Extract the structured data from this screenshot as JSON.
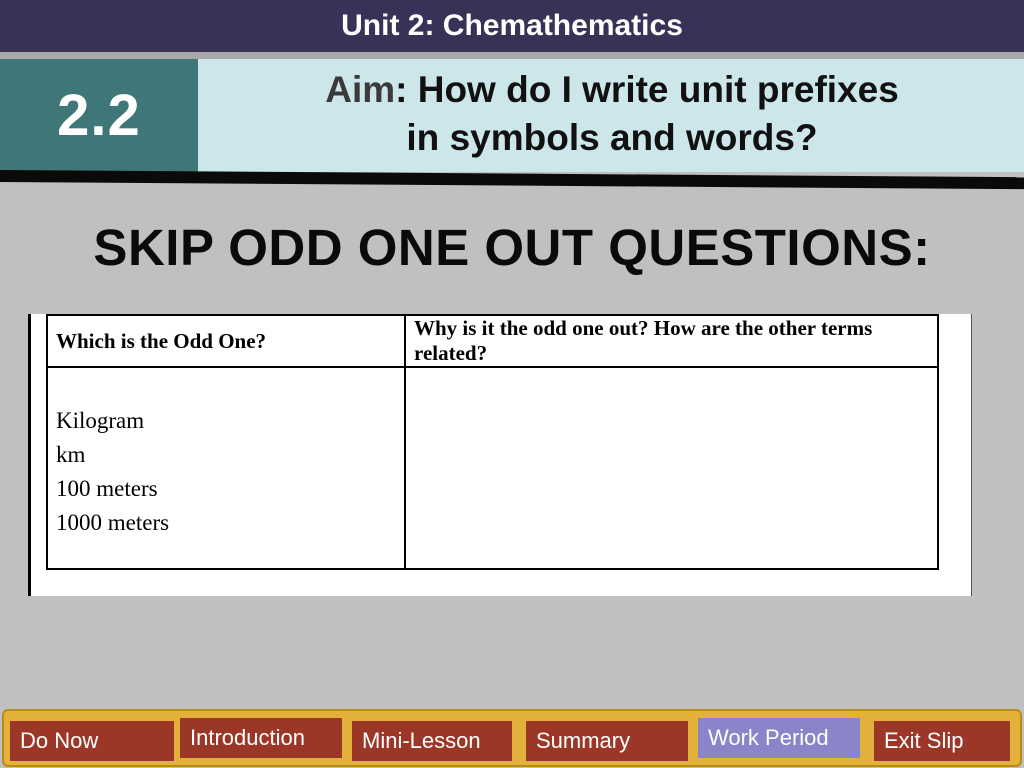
{
  "header": {
    "unit_title": "Unit 2: Chemathematics",
    "lesson_number": "2.2",
    "aim_label": "Aim",
    "aim_line1": ": How do I write unit prefixes",
    "aim_line2": "in symbols and words?"
  },
  "instruction": "SKIP ODD ONE OUT QUESTIONS:",
  "worksheet": {
    "columns": [
      "Which is the Odd One?",
      "Why is it the odd one out? How are the other terms related?"
    ],
    "items": [
      "Kilogram",
      "km",
      "100 meters",
      "1000 meters"
    ]
  },
  "nav": {
    "items": [
      {
        "label": "Do Now",
        "active": false
      },
      {
        "label": "Introduction",
        "active": false
      },
      {
        "label": "Mini-Lesson",
        "active": false
      },
      {
        "label": "Summary",
        "active": false
      },
      {
        "label": "Work Period",
        "active": true
      },
      {
        "label": "Exit Slip",
        "active": false
      }
    ]
  },
  "colors": {
    "title_bar": "#3a3156",
    "lesson_box": "#3f7678",
    "aim_band": "#cde6ea",
    "nav_bar": "#e3b13a",
    "nav_button": "#9c3727",
    "nav_active": "#8a84c9"
  }
}
